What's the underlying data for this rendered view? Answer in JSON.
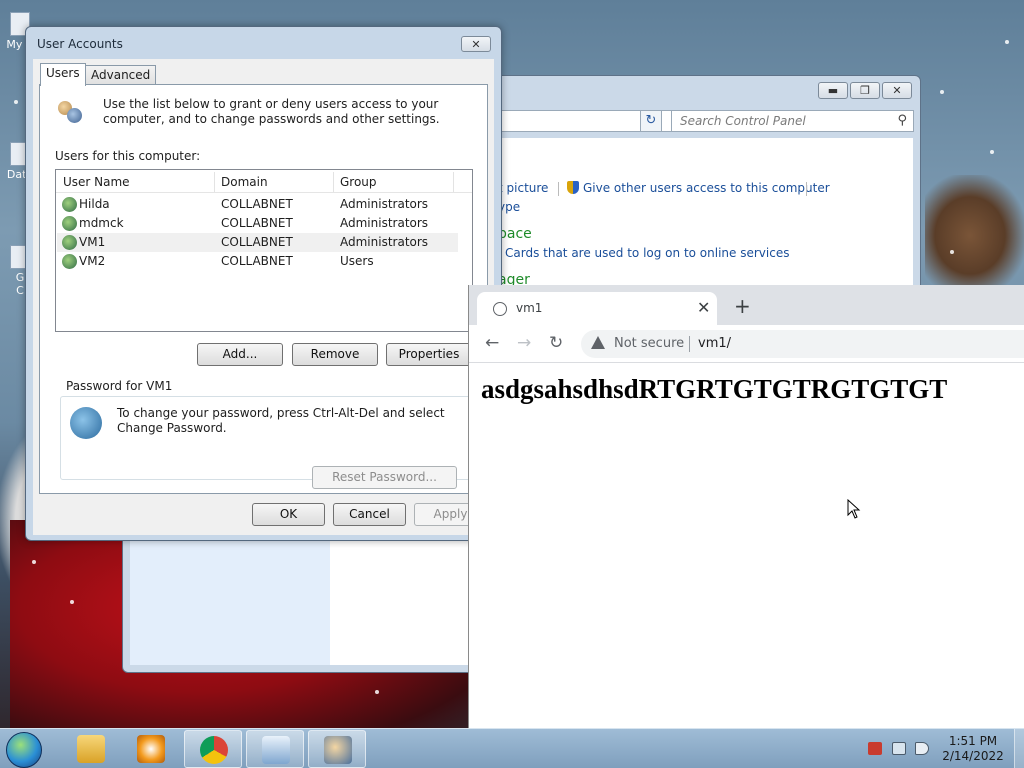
{
  "desktop": {
    "icons": [
      {
        "label": "My C"
      },
      {
        "label": "Data"
      },
      {
        "label": "G\nC"
      }
    ]
  },
  "control_panel": {
    "search_placeholder": "Search Control Panel",
    "link_picture": "t picture",
    "link_give_access": "Give other users access to this computer",
    "link_type": "ype",
    "heading_space": "pace",
    "link_cards": "Cards that are used to log on to online services",
    "heading_ager": "ager"
  },
  "user_accounts": {
    "title": "User Accounts",
    "tabs": [
      "Users",
      "Advanced"
    ],
    "intro": "Use the list below to grant or deny users access to your computer, and to change passwords and other settings.",
    "users_label": "Users for this computer:",
    "columns": [
      "User Name",
      "Domain",
      "Group"
    ],
    "rows": [
      {
        "name": "Hilda",
        "domain": "COLLABNET",
        "group": "Administrators"
      },
      {
        "name": "mdmck",
        "domain": "COLLABNET",
        "group": "Administrators"
      },
      {
        "name": "VM1",
        "domain": "COLLABNET",
        "group": "Administrators"
      },
      {
        "name": "VM2",
        "domain": "COLLABNET",
        "group": "Users"
      }
    ],
    "buttons": {
      "add": "Add...",
      "remove": "Remove",
      "properties": "Properties"
    },
    "password_group": "Password for VM1",
    "password_text": "To change your password, press Ctrl-Alt-Del and select Change Password.",
    "reset_password": "Reset Password...",
    "ok": "OK",
    "cancel": "Cancel",
    "apply": "Apply"
  },
  "chrome": {
    "tab_title": "vm1",
    "not_secure": "Not secure",
    "url": "vm1/",
    "page_text": "asdgsahsdhsdRTGRTGTGTRGTGTGT"
  },
  "taskbar": {
    "time": "1:51 PM",
    "date": "2/14/2022"
  },
  "colors": {
    "link": "#1a4e99",
    "heading": "#1f8b2a",
    "selection": "#f0f0f0"
  }
}
